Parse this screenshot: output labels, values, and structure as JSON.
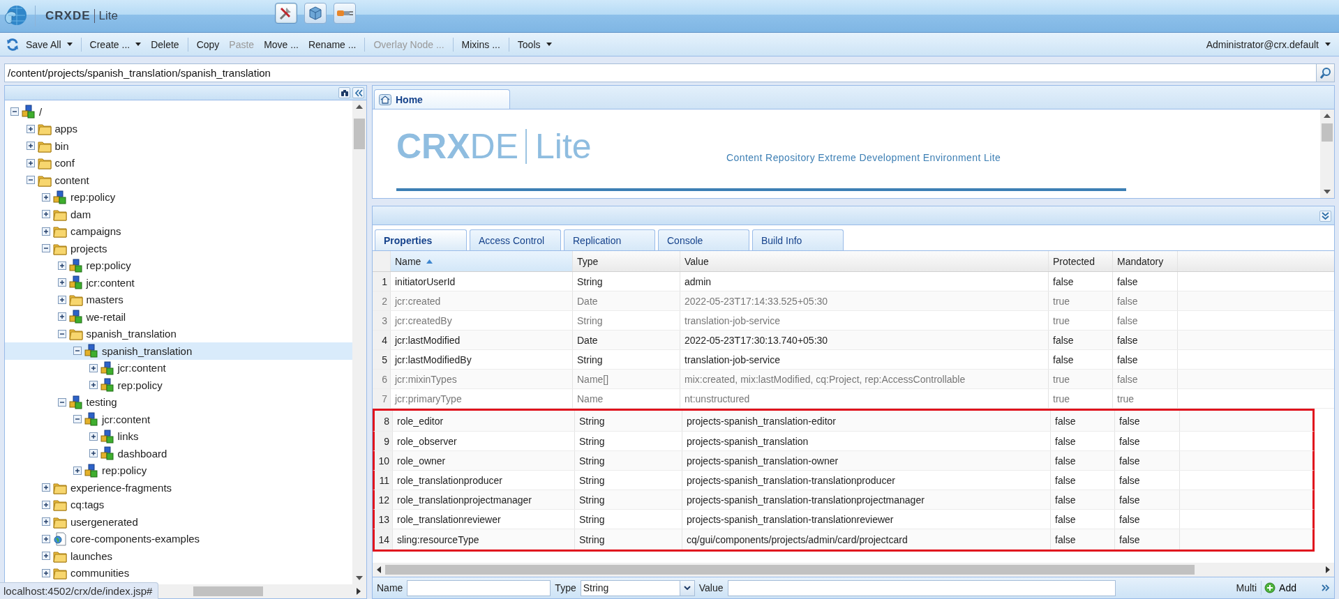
{
  "header": {
    "logo_text": "CRXDE",
    "logo_sub": "Lite",
    "mode_buttons": [
      {
        "kind": "tools",
        "selected": true
      },
      {
        "kind": "cube",
        "selected": false
      },
      {
        "kind": "plug",
        "selected": false
      }
    ]
  },
  "toolbar": {
    "items": [
      {
        "kind": "refresh"
      },
      {
        "kind": "menu",
        "label": "Save All",
        "disabled": false
      },
      {
        "kind": "sep"
      },
      {
        "kind": "menu",
        "label": "Create ...",
        "disabled": false
      },
      {
        "kind": "button",
        "label": "Delete",
        "disabled": false
      },
      {
        "kind": "sep"
      },
      {
        "kind": "button",
        "label": "Copy",
        "disabled": false
      },
      {
        "kind": "button",
        "label": "Paste",
        "disabled": true
      },
      {
        "kind": "button",
        "label": "Move ...",
        "disabled": false
      },
      {
        "kind": "button",
        "label": "Rename ...",
        "disabled": false
      },
      {
        "kind": "sep"
      },
      {
        "kind": "button",
        "label": "Overlay Node ...",
        "disabled": true
      },
      {
        "kind": "sep"
      },
      {
        "kind": "button",
        "label": "Mixins ...",
        "disabled": false
      },
      {
        "kind": "sep"
      },
      {
        "kind": "menu",
        "label": "Tools",
        "disabled": false
      }
    ],
    "user": "Administrator@crx.default"
  },
  "path_field": {
    "value": "/content/projects/spanish_translation/spanish_translation"
  },
  "tree": {
    "items": [
      {
        "label": "/",
        "kind": "node",
        "expanded": true,
        "selected": false,
        "children": [
          {
            "label": "apps",
            "kind": "folder",
            "expanded": false,
            "selected": false
          },
          {
            "label": "bin",
            "kind": "folder",
            "expanded": false,
            "selected": false
          },
          {
            "label": "conf",
            "kind": "folder",
            "expanded": false,
            "selected": false
          },
          {
            "label": "content",
            "kind": "folder",
            "expanded": true,
            "selected": false,
            "children": [
              {
                "label": "rep:policy",
                "kind": "node",
                "expanded": false,
                "selected": false
              },
              {
                "label": "dam",
                "kind": "folder",
                "expanded": false,
                "selected": false
              },
              {
                "label": "campaigns",
                "kind": "folder",
                "expanded": false,
                "selected": false
              },
              {
                "label": "projects",
                "kind": "folder",
                "expanded": true,
                "selected": false,
                "children": [
                  {
                    "label": "rep:policy",
                    "kind": "node",
                    "expanded": false,
                    "selected": false
                  },
                  {
                    "label": "jcr:content",
                    "kind": "node",
                    "expanded": false,
                    "selected": false
                  },
                  {
                    "label": "masters",
                    "kind": "folder",
                    "expanded": false,
                    "selected": false
                  },
                  {
                    "label": "we-retail",
                    "kind": "node",
                    "expanded": false,
                    "selected": false
                  },
                  {
                    "label": "spanish_translation",
                    "kind": "folder",
                    "expanded": true,
                    "selected": false,
                    "children": [
                      {
                        "label": "spanish_translation",
                        "kind": "node",
                        "expanded": true,
                        "selected": true,
                        "children": [
                          {
                            "label": "jcr:content",
                            "kind": "node",
                            "expanded": false,
                            "selected": false
                          },
                          {
                            "label": "rep:policy",
                            "kind": "node",
                            "expanded": false,
                            "selected": false
                          }
                        ]
                      }
                    ]
                  },
                  {
                    "label": "testing",
                    "kind": "node",
                    "expanded": true,
                    "selected": false,
                    "children": [
                      {
                        "label": "jcr:content",
                        "kind": "node",
                        "expanded": true,
                        "selected": false,
                        "children": [
                          {
                            "label": "links",
                            "kind": "node",
                            "expanded": false,
                            "selected": false
                          },
                          {
                            "label": "dashboard",
                            "kind": "node",
                            "expanded": false,
                            "selected": false
                          }
                        ]
                      },
                      {
                        "label": "rep:policy",
                        "kind": "node",
                        "expanded": false,
                        "selected": false
                      }
                    ]
                  }
                ]
              },
              {
                "label": "experience-fragments",
                "kind": "folder",
                "expanded": false,
                "selected": false
              },
              {
                "label": "cq:tags",
                "kind": "folder",
                "expanded": false,
                "selected": false
              },
              {
                "label": "usergenerated",
                "kind": "folder",
                "expanded": false,
                "selected": false
              },
              {
                "label": "core-components-examples",
                "kind": "page",
                "expanded": false,
                "selected": false
              },
              {
                "label": "launches",
                "kind": "folder",
                "expanded": false,
                "selected": false
              },
              {
                "label": "communities",
                "kind": "folder",
                "expanded": false,
                "selected": false
              }
            ]
          }
        ]
      }
    ]
  },
  "editor_tabs": [
    {
      "label": "Home",
      "selected": true
    }
  ],
  "home": {
    "logo": "**CRX**DE",
    "logo_sub": "Lite",
    "tagline": "Content Repository Extreme Development Environment Lite"
  },
  "property_tabs": [
    {
      "label": "Properties",
      "selected": true
    },
    {
      "label": "Access Control",
      "selected": false
    },
    {
      "label": "Replication",
      "selected": false
    },
    {
      "label": "Console",
      "selected": false
    },
    {
      "label": "Build Info",
      "selected": false
    }
  ],
  "table": {
    "columns": [
      {
        "label": "Name",
        "sorted": true
      },
      {
        "label": "Type",
        "sorted": false
      },
      {
        "label": "Value",
        "sorted": false
      },
      {
        "label": "Protected",
        "sorted": false
      },
      {
        "label": "Mandatory",
        "sorted": false
      }
    ],
    "rows": [
      {
        "index": "1",
        "name": "initiatorUserId",
        "type": "String",
        "value": "admin",
        "protected": "false",
        "mandatory": "false",
        "disabled": false,
        "highlighted": false
      },
      {
        "index": "2",
        "name": "jcr:created",
        "type": "Date",
        "value": "2022-05-23T17:14:33.525+05:30",
        "protected": "true",
        "mandatory": "false",
        "disabled": true,
        "highlighted": false
      },
      {
        "index": "3",
        "name": "jcr:createdBy",
        "type": "String",
        "value": "translation-job-service",
        "protected": "true",
        "mandatory": "false",
        "disabled": true,
        "highlighted": false
      },
      {
        "index": "4",
        "name": "jcr:lastModified",
        "type": "Date",
        "value": "2022-05-23T17:30:13.740+05:30",
        "protected": "false",
        "mandatory": "false",
        "disabled": false,
        "highlighted": false
      },
      {
        "index": "5",
        "name": "jcr:lastModifiedBy",
        "type": "String",
        "value": "translation-job-service",
        "protected": "false",
        "mandatory": "false",
        "disabled": false,
        "highlighted": false
      },
      {
        "index": "6",
        "name": "jcr:mixinTypes",
        "type": "Name[]",
        "value": "mix:created, mix:lastModified, cq:Project, rep:AccessControllable",
        "protected": "true",
        "mandatory": "false",
        "disabled": true,
        "highlighted": false
      },
      {
        "index": "7",
        "name": "jcr:primaryType",
        "type": "Name",
        "value": "nt:unstructured",
        "protected": "true",
        "mandatory": "true",
        "disabled": true,
        "highlighted": false
      },
      {
        "index": "8",
        "name": "role_editor",
        "type": "String",
        "value": "projects-spanish_translation-editor",
        "protected": "false",
        "mandatory": "false",
        "disabled": false,
        "highlighted": true
      },
      {
        "index": "9",
        "name": "role_observer",
        "type": "String",
        "value": "projects-spanish_translation",
        "protected": "false",
        "mandatory": "false",
        "disabled": false,
        "highlighted": true
      },
      {
        "index": "10",
        "name": "role_owner",
        "type": "String",
        "value": "projects-spanish_translation-owner",
        "protected": "false",
        "mandatory": "false",
        "disabled": false,
        "highlighted": true
      },
      {
        "index": "11",
        "name": "role_translationproducer",
        "type": "String",
        "value": "projects-spanish_translation-translationproducer",
        "protected": "false",
        "mandatory": "false",
        "disabled": false,
        "highlighted": true
      },
      {
        "index": "12",
        "name": "role_translationprojectmanager",
        "type": "String",
        "value": "projects-spanish_translation-translationprojectmanager",
        "protected": "false",
        "mandatory": "false",
        "disabled": false,
        "highlighted": true
      },
      {
        "index": "13",
        "name": "role_translationreviewer",
        "type": "String",
        "value": "projects-spanish_translation-translationreviewer",
        "protected": "false",
        "mandatory": "false",
        "disabled": false,
        "highlighted": true
      },
      {
        "index": "14",
        "name": "sling:resourceType",
        "type": "String",
        "value": "cq/gui/components/projects/admin/card/projectcard",
        "protected": "false",
        "mandatory": "false",
        "disabled": false,
        "highlighted": true
      }
    ]
  },
  "add_form": {
    "name_label": "Name",
    "type_label": "Type",
    "type_value": "String",
    "value_label": "Value",
    "multi_label": "Multi",
    "add_label": "Add"
  },
  "status_url": "localhost:4502/crx/de/index.jsp#"
}
